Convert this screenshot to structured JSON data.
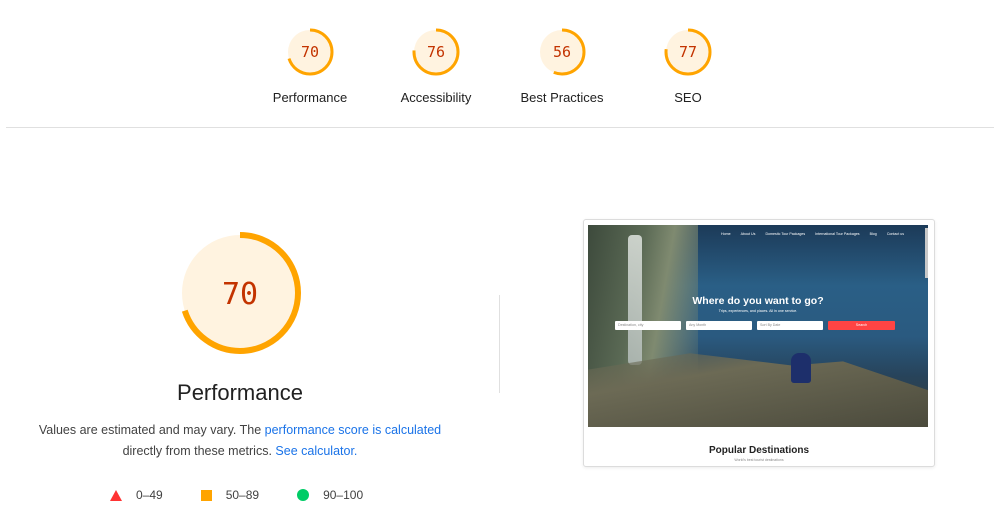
{
  "top_scores": [
    {
      "score": "70",
      "label": "Performance"
    },
    {
      "score": "76",
      "label": "Accessibility"
    },
    {
      "score": "56",
      "label": "Best Practices"
    },
    {
      "score": "77",
      "label": "SEO"
    }
  ],
  "performance": {
    "score": "70",
    "title": "Performance",
    "note_prefix": "Values are estimated and may vary. The ",
    "note_link1": "performance score is calculated",
    "note_middle": "directly from these metrics. ",
    "note_link2": "See calculator."
  },
  "legend": [
    {
      "range": "0–49",
      "color": "#ff3333"
    },
    {
      "range": "50–89",
      "color": "#ffa400"
    },
    {
      "range": "90–100",
      "color": "#00cc66"
    }
  ],
  "screenshot": {
    "nav": [
      "Home",
      "About Us",
      "Domestic Tour Packages",
      "International Tour Packages",
      "Blog",
      "Contact us"
    ],
    "headline": "Where do you want to go?",
    "subtitle": "Trips, experiences, and places. All in one service.",
    "field1": "Destination, city",
    "field2": "Any Month",
    "field3": "Sort By Date",
    "button": "Search",
    "section_title": "Popular Destinations",
    "section_subtitle": "World's best tourist destinations"
  },
  "colors": {
    "average": "#ffa400",
    "average_bg": "#fff3e0",
    "average_text": "#c33300",
    "link": "#1a73e8"
  }
}
